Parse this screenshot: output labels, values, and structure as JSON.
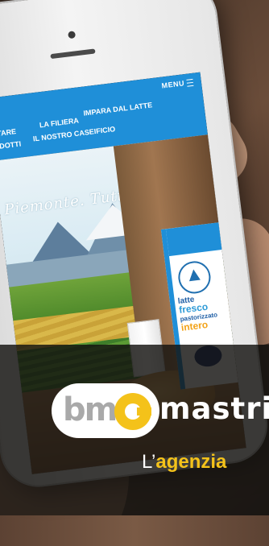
{
  "site": {
    "menu_label": "MENU",
    "nav": [
      "ENTARE",
      "RODOTTI",
      "LA FILIERA",
      "IL NOSTRO CASEIFICIO",
      "IMPARA DAL LATTE"
    ],
    "tagline": "Piemonte. Tutti i giorni."
  },
  "carton": {
    "line1": "latte",
    "line2": "fresco",
    "line3": "pastorizzato",
    "line4": "intero"
  },
  "logo": {
    "mark": "bm",
    "name": "mastri"
  },
  "tagline": {
    "prefix": "L’",
    "highlight": "agenzia"
  },
  "colors": {
    "site_blue": "#1f8fd8",
    "brand_yellow": "#f4c21a",
    "logo_grey": "#a9a9a9"
  }
}
